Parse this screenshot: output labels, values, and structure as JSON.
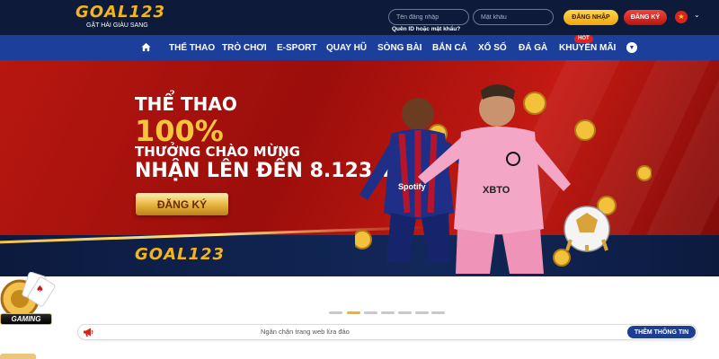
{
  "header": {
    "logo_text": "GOAL123",
    "logo_slogan": "GẶT HÁI GIÀU SANG",
    "username_placeholder": "Tên đăng nhập",
    "password_placeholder": "Mật khẩu",
    "forgot_label": "Quên ID hoặc mật khẩu?",
    "login_label": "ĐĂNG NHẬP",
    "register_label": "ĐĂNG KÝ",
    "language_icon": "vietnam-flag-icon"
  },
  "nav": {
    "items": [
      {
        "label": "THỂ THAO"
      },
      {
        "label": "TRÒ CHƠI"
      },
      {
        "label": "E-SPORT"
      },
      {
        "label": "QUAY HŨ"
      },
      {
        "label": "SÒNG BÀI"
      },
      {
        "label": "BẮN CÁ"
      },
      {
        "label": "XỔ SỐ"
      },
      {
        "label": "ĐÁ GÀ"
      },
      {
        "label": "KHUYẾN MÃI"
      }
    ],
    "hot_badge": "HOT"
  },
  "banner": {
    "line1": "THỂ THAO",
    "line2": "100%",
    "line3": "THƯỞNG CHÀO MỪNG",
    "line4": "NHẬN LÊN ĐẾN 8.123 TRIỆU",
    "cta_label": "ĐĂNG KÝ",
    "logo_text": "GOAL123",
    "jersey_sponsor_1": "Spotify",
    "jersey_sponsor_2": "XBTO"
  },
  "side_widget": {
    "label": "GAMING"
  },
  "carousel": {
    "slide_count": 7,
    "active_index": 1
  },
  "notice": {
    "text": "Ngăn chặn trang web lừa đảo",
    "button_label": "THÊM THÔNG TIN",
    "icon": "megaphone-icon"
  },
  "colors": {
    "header_bg": "#0d1a3a",
    "nav_bg": "#1d3f9c",
    "gold": "#f2b51c",
    "red": "#d6231b"
  }
}
